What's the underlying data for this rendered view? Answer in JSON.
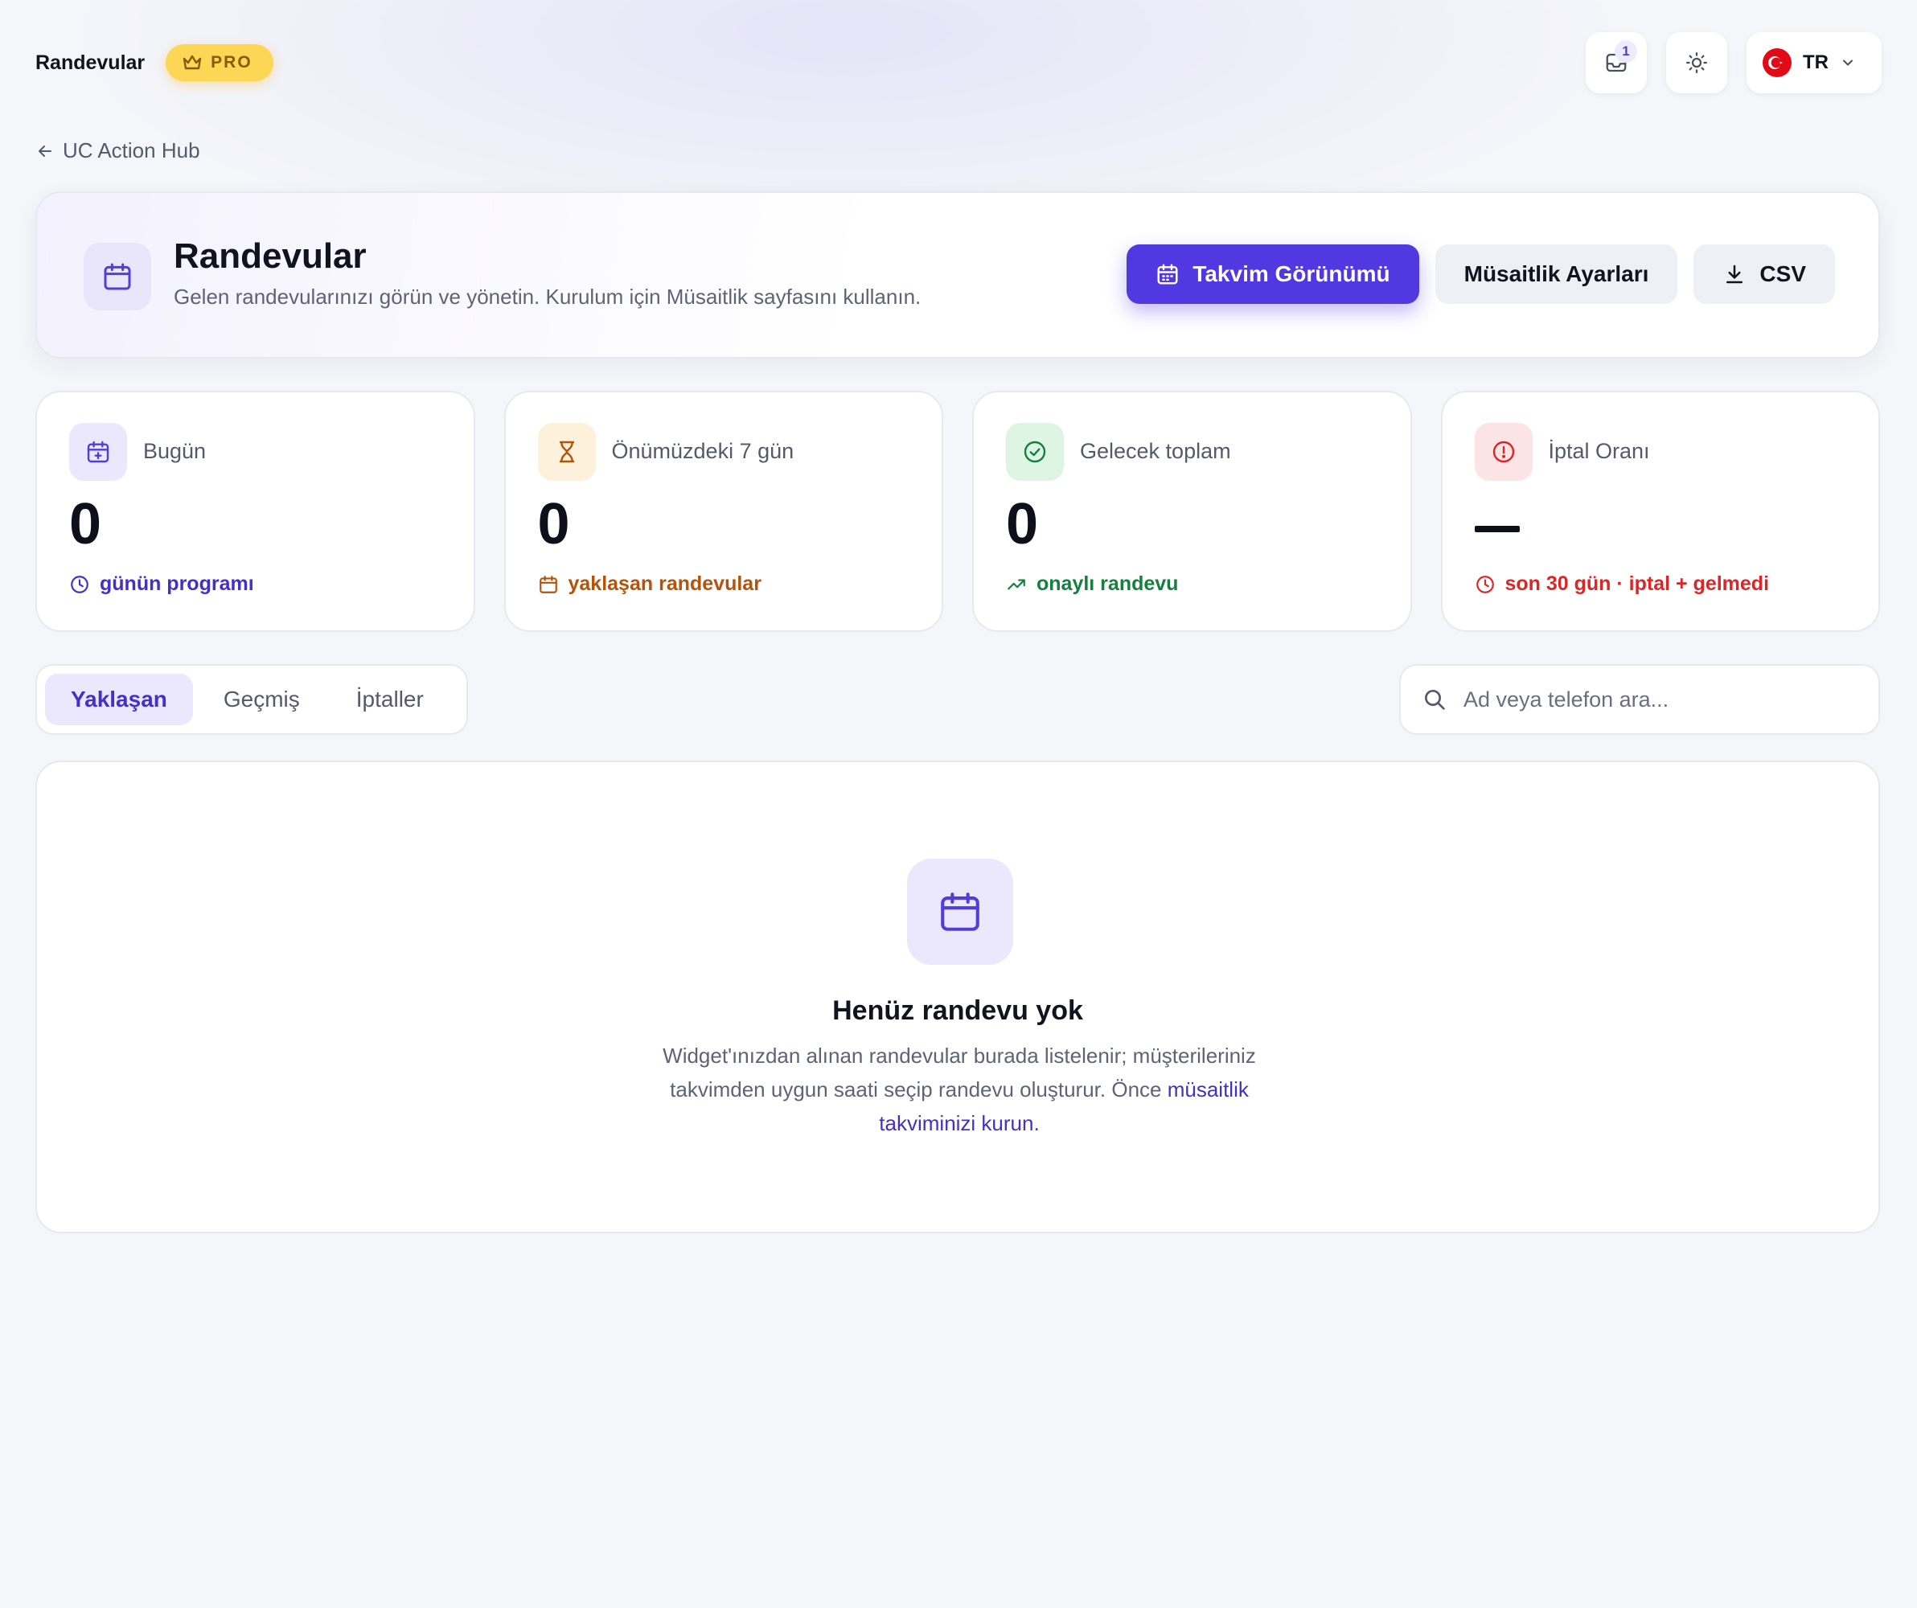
{
  "topbar": {
    "title": "Randevular",
    "pro_label": "PRO",
    "notifications_count": "1",
    "language_code": "TR"
  },
  "back_link": {
    "label": "UC Action Hub"
  },
  "header": {
    "title": "Randevular",
    "subtitle": "Gelen randevularınızı görün ve yönetin. Kurulum için Müsaitlik sayfasını kullanın.",
    "calendar_view_label": "Takvim Görünümü",
    "availability_settings_label": "Müsaitlik Ayarları",
    "csv_label": "CSV"
  },
  "stats": [
    {
      "label": "Bugün",
      "value": "0",
      "footer": "günün programı",
      "color": "#4330c8",
      "icon": "calendar-plus-icon"
    },
    {
      "label": "Önümüzdeki 7 gün",
      "value": "0",
      "footer": "yaklaşan randevular",
      "color": "#b45309",
      "icon": "hourglass-icon"
    },
    {
      "label": "Gelecek toplam",
      "value": "0",
      "footer": "onaylı randevu",
      "color": "#15803d",
      "icon": "check-circle-icon"
    },
    {
      "label": "İptal Oranı",
      "value": "",
      "footer": "son 30 gün · iptal + gelmedi",
      "color": "#dc2626",
      "icon": "alert-circle-icon"
    }
  ],
  "tabs": [
    {
      "label": "Yaklaşan",
      "active": true
    },
    {
      "label": "Geçmiş",
      "active": false
    },
    {
      "label": "İptaller",
      "active": false
    }
  ],
  "search": {
    "placeholder": "Ad veya telefon ara..."
  },
  "empty_state": {
    "title": "Henüz randevu yok",
    "text_before": "Widget'ınızdan alınan randevular burada listelenir; müşterileriniz takvimden uygun saati seçip randevu oluşturur. Önce ",
    "link_text": "müsaitlik takviminizi kurun",
    "text_after": "."
  },
  "colors": {
    "accent": "#5138e0",
    "pro_badge": "#fcd654",
    "background": "#f5f6fa"
  }
}
